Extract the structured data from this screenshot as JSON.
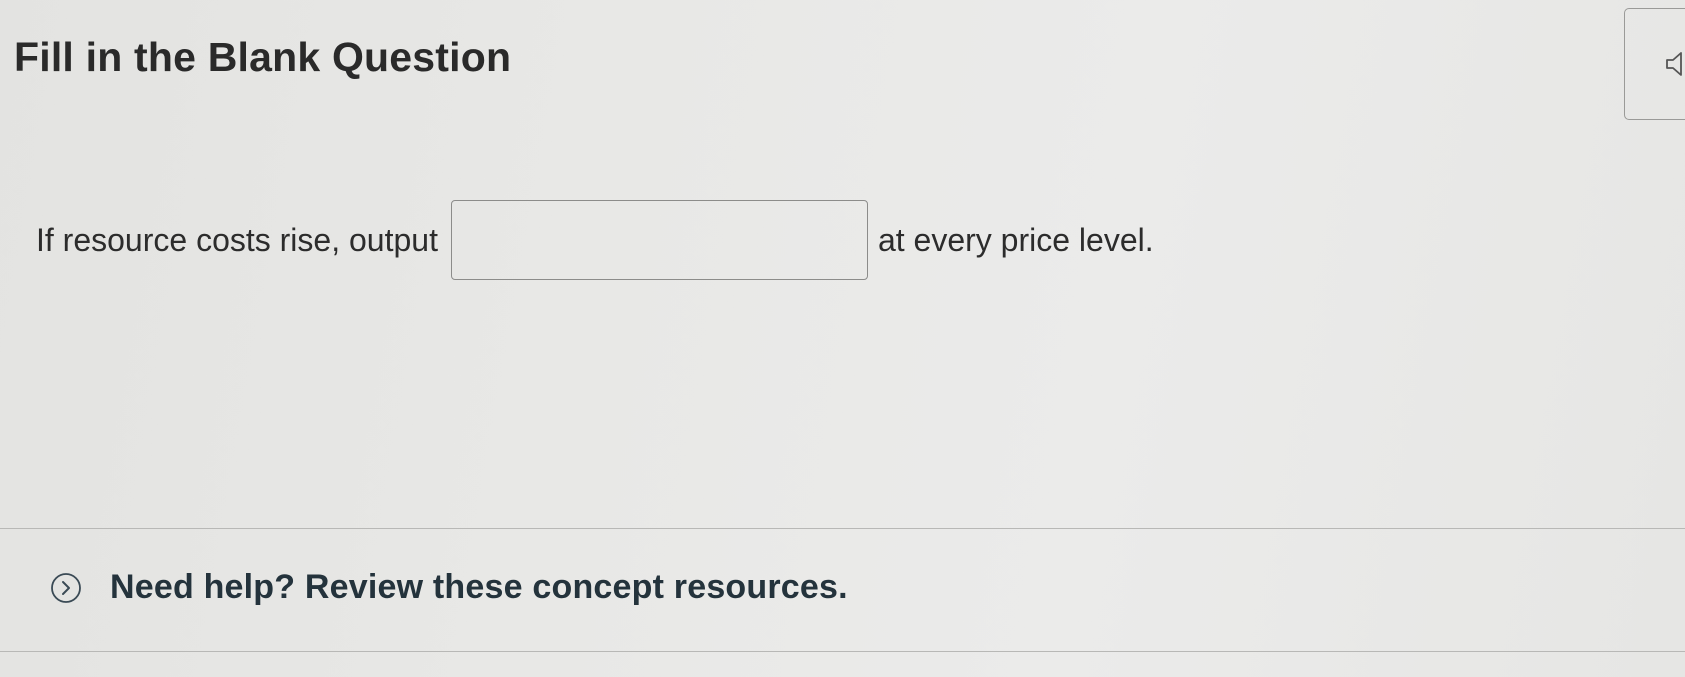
{
  "question": {
    "title": "Fill in the Blank Question",
    "prefix": "If resource costs rise, output",
    "blank_value": "",
    "suffix": "at every price level."
  },
  "help": {
    "label": "Need help? Review these concept resources."
  },
  "icons": {
    "audio": "speaker-icon",
    "help_toggle": "chevron-right-icon"
  }
}
